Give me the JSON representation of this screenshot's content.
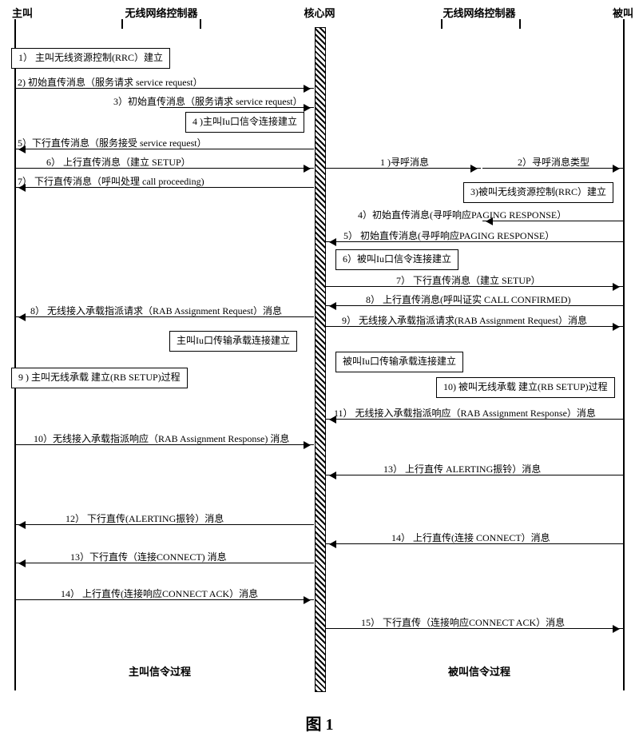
{
  "actors": {
    "caller": "主叫",
    "rnc_left": "无线网络控制器",
    "core": "核心网",
    "rnc_right": "无线网络控制器",
    "callee": "被叫"
  },
  "left": {
    "b1": "1） 主叫无线资源控制(RRC）建立",
    "m2": "2) 初始直传消息（服务请求 service request）",
    "m3": "3）初始直传消息（服务请求 service request）",
    "b4": "4 )主叫Iu口信令连接建立",
    "m5": "5）下行直传消息（服务接受 service request）",
    "m6": "6） 上行直传消息（建立 SETUP）",
    "m7": "7） 下行直传消息（呼叫处理 call proceeding)",
    "m8": "8） 无线接入承载指派请求（RAB Assignment Request）消息",
    "iu_bearer_left": "主叫Iu口传输承载连接建立",
    "b9": "9 ) 主叫无线承载 建立(RB SETUP)过程",
    "m10": "10）无线接入承载指派响应（RAB Assignment Response) 消息",
    "m12": "12） 下行直传(ALERTING振铃）消息",
    "m13": "13）下行直传（连接CONNECT) 消息",
    "m14": "14） 上行直传(连接响应CONNECT ACK）消息"
  },
  "right": {
    "m1": "1 )寻呼消息",
    "m2": "2）寻呼消息类型",
    "b3": "3)被叫无线资源控制(RRC）建立",
    "m4": "4）初始直传消息(寻呼响应PAGING RESPONSE）",
    "m5": "5） 初始直传消息(寻呼响应PAGING RESPONSE）",
    "b6": "6）被叫Iu口信令连接建立",
    "m7": "7） 下行直传消息（建立 SETUP）",
    "m8": "8） 上行直传消息(呼叫证实 CALL CONFIRMED)",
    "m9": "9） 无线接入承载指派请求(RAB Assignment Request）消息",
    "iu_bearer_right": "被叫Iu口传输承载连接建立",
    "b10": "10) 被叫无线承载 建立(RB SETUP)过程",
    "m11": "11） 无线接入承载指派响应（RAB Assignment Response）消息",
    "m13": "13） 上行直传 ALERTING振铃）消息",
    "m14": "14） 上行直传(连接 CONNECT）消息",
    "m15": "15） 下行直传（连接响应CONNECT ACK）消息"
  },
  "footer": {
    "left": "主叫信令过程",
    "right": "被叫信令过程"
  },
  "figure": "图 1"
}
